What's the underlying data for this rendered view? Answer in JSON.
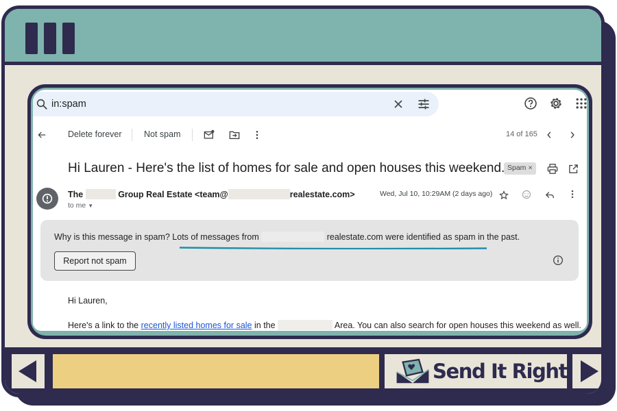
{
  "search": {
    "query": "in:spam"
  },
  "toolbar": {
    "delete_forever": "Delete forever",
    "not_spam": "Not spam",
    "count": "14 of 165"
  },
  "message": {
    "subject": "Hi Lauren - Here's the list of homes for sale and open houses this weekend...",
    "label_chip": "Spam",
    "label_chip_close": "×",
    "sender_prefix": "The",
    "sender_middle": "Group Real Estate <team@",
    "sender_suffix": "realestate.com>",
    "to": "to me",
    "date": "Wed, Jul 10, 10:29AM (2 days ago)"
  },
  "spam_warning": {
    "question": "Why is this message in spam?",
    "reason_prefix": "Lots of messages from",
    "reason_suffix": "realestate.com were identified as spam in the past.",
    "report_button": "Report not spam"
  },
  "body": {
    "greeting": "Hi Lauren,",
    "line_prefix": "Here's a link to the",
    "link_text": "recently listed homes for sale",
    "line_middle": "in the",
    "line_suffix": "Area. You can also search for open houses this weekend as well."
  },
  "brand": {
    "logo_text": "Send It Right",
    "colors": {
      "frame": "#2e2b4f",
      "teal": "#7fb3ad",
      "cream": "#e9e4d8",
      "yellow": "#edcf82",
      "link": "#1a56d6",
      "underline_accent": "#1f8fa8"
    }
  },
  "icons": [
    "search-icon",
    "close-icon",
    "tune-icon",
    "help-icon",
    "gear-icon",
    "apps-icon",
    "back-arrow-icon",
    "mark-unread-icon",
    "move-to-icon",
    "more-vert-icon",
    "chevron-left-icon",
    "chevron-right-icon",
    "print-icon",
    "open-new-window-icon",
    "star-icon",
    "emoji-icon",
    "reply-icon",
    "info-icon",
    "envelope-heart-icon"
  ]
}
